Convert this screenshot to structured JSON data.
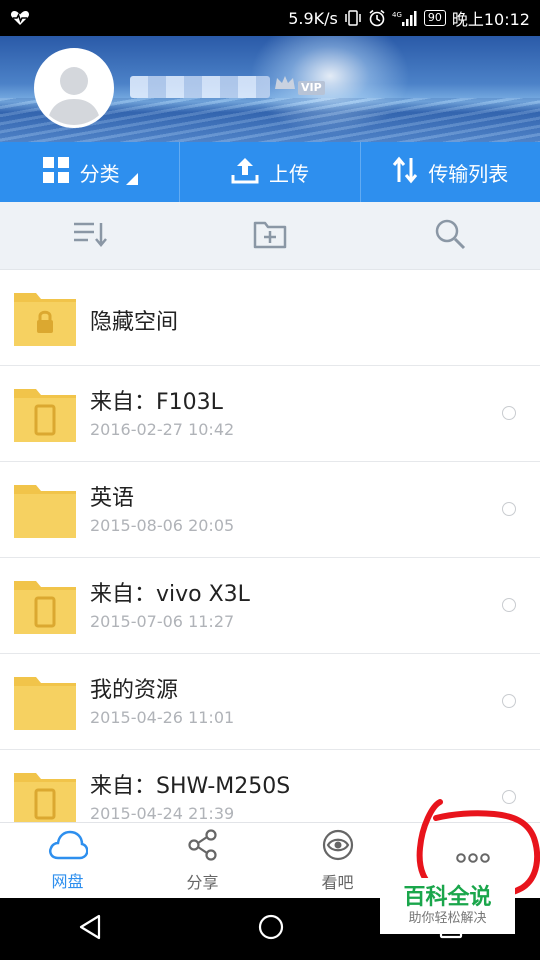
{
  "status_bar": {
    "network_speed": "5.9K/s",
    "battery": "90",
    "time": "晚上10:12"
  },
  "header": {
    "vip_label": "VIP"
  },
  "actions": [
    {
      "label": "分类",
      "icon": "grid-icon"
    },
    {
      "label": "上传",
      "icon": "upload-icon"
    },
    {
      "label": "传输列表",
      "icon": "transfer-icon"
    }
  ],
  "toolbar": {
    "icons": [
      "sort-icon",
      "new-folder-icon",
      "search-icon"
    ]
  },
  "files": [
    {
      "name": "隐藏空间",
      "date": "",
      "icon": "locked-folder-icon"
    },
    {
      "name": "来自：F103L",
      "date": "2016-02-27  10:42",
      "icon": "device-folder-icon"
    },
    {
      "name": "英语",
      "date": "2015-08-06  20:05",
      "icon": "folder-icon"
    },
    {
      "name": "来自：vivo X3L",
      "date": "2015-07-06  11:27",
      "icon": "device-folder-icon"
    },
    {
      "name": "我的资源",
      "date": "2015-04-26  11:01",
      "icon": "folder-icon"
    },
    {
      "name": "来自：SHW-M250S",
      "date": "2015-04-24  21:39",
      "icon": "device-folder-icon"
    }
  ],
  "bottom_nav": [
    {
      "label": "网盘",
      "icon": "cloud-icon",
      "active": true
    },
    {
      "label": "分享",
      "icon": "share-icon",
      "active": false
    },
    {
      "label": "看吧",
      "icon": "eye-icon",
      "active": false
    },
    {
      "label": "",
      "icon": "more-icon",
      "active": false
    }
  ],
  "watermark": {
    "main": "百科全说",
    "sub": "助你轻松解决"
  },
  "colors": {
    "accent": "#2e8fee",
    "folder": "#f5cd5a",
    "annotation": "#e8141c"
  }
}
